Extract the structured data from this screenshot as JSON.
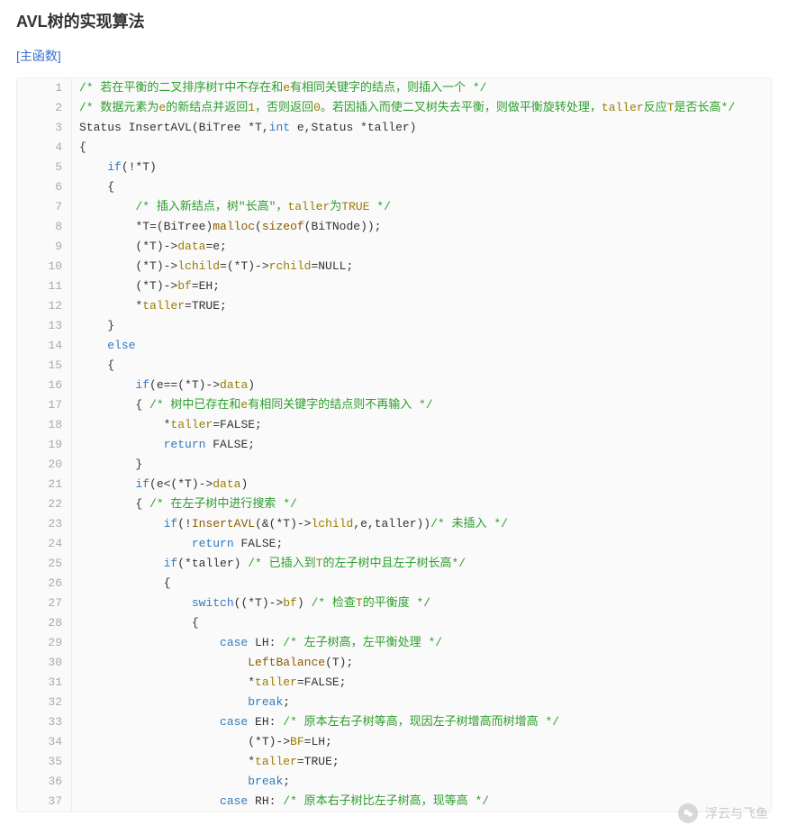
{
  "title": "AVL树的实现算法",
  "section_label": "[主函数]",
  "watermark": "浮云与飞鱼",
  "code_lines": [
    {
      "n": 1,
      "seg": [
        [
          "comment",
          "/* 若在平衡的二叉排序树T中不存在和"
        ],
        [
          "id",
          "e"
        ],
        [
          "comment",
          "有相同关键字的结点，则插入一个 */"
        ]
      ]
    },
    {
      "n": 2,
      "seg": [
        [
          "comment",
          "/* 数据元素为"
        ],
        [
          "id",
          "e"
        ],
        [
          "comment",
          "的新结点并返回"
        ],
        [
          "id",
          "1"
        ],
        [
          "comment",
          "，否则返回"
        ],
        [
          "id",
          "0"
        ],
        [
          "comment",
          "。若因插入而使二叉树失去平衡，则做平衡旋转处理，"
        ],
        [
          "id",
          "taller"
        ],
        [
          "comment",
          "反应"
        ],
        [
          "id",
          "T"
        ],
        [
          "comment",
          "是否长高*/"
        ]
      ]
    },
    {
      "n": 3,
      "seg": [
        [
          "plain",
          "Status InsertAVL(BiTree *T,"
        ],
        [
          "type",
          "int"
        ],
        [
          "plain",
          " e,Status *taller)"
        ]
      ]
    },
    {
      "n": 4,
      "seg": [
        [
          "plain",
          "{"
        ]
      ]
    },
    {
      "n": 5,
      "seg": [
        [
          "plain",
          "    "
        ],
        [
          "flow",
          "if"
        ],
        [
          "plain",
          "(!*T)"
        ]
      ]
    },
    {
      "n": 6,
      "seg": [
        [
          "plain",
          "    {"
        ]
      ]
    },
    {
      "n": 7,
      "seg": [
        [
          "plain",
          "        "
        ],
        [
          "comment",
          "/* 插入新结点，树\"长高\"，"
        ],
        [
          "id",
          "taller"
        ],
        [
          "comment",
          "为"
        ],
        [
          "id",
          "TRUE"
        ],
        [
          "comment",
          " */"
        ]
      ]
    },
    {
      "n": 8,
      "seg": [
        [
          "plain",
          "        *T=(BiTree)"
        ],
        [
          "call",
          "malloc"
        ],
        [
          "plain",
          "("
        ],
        [
          "call",
          "sizeof"
        ],
        [
          "plain",
          "(BiTNode));"
        ]
      ]
    },
    {
      "n": 9,
      "seg": [
        [
          "plain",
          "        (*T)->"
        ],
        [
          "id",
          "data"
        ],
        [
          "plain",
          "=e;"
        ]
      ]
    },
    {
      "n": 10,
      "seg": [
        [
          "plain",
          "        (*T)->"
        ],
        [
          "id",
          "lchild"
        ],
        [
          "plain",
          "=(*T)->"
        ],
        [
          "id",
          "rchild"
        ],
        [
          "plain",
          "=NULL;"
        ]
      ]
    },
    {
      "n": 11,
      "seg": [
        [
          "plain",
          "        (*T)->"
        ],
        [
          "id",
          "bf"
        ],
        [
          "plain",
          "=EH;"
        ]
      ]
    },
    {
      "n": 12,
      "seg": [
        [
          "plain",
          "        *"
        ],
        [
          "id",
          "taller"
        ],
        [
          "plain",
          "=TRUE;"
        ]
      ]
    },
    {
      "n": 13,
      "seg": [
        [
          "plain",
          "    }"
        ]
      ]
    },
    {
      "n": 14,
      "seg": [
        [
          "plain",
          "    "
        ],
        [
          "flow",
          "else"
        ]
      ]
    },
    {
      "n": 15,
      "seg": [
        [
          "plain",
          "    {"
        ]
      ]
    },
    {
      "n": 16,
      "seg": [
        [
          "plain",
          "        "
        ],
        [
          "flow",
          "if"
        ],
        [
          "plain",
          "(e==(*T)->"
        ],
        [
          "id",
          "data"
        ],
        [
          "plain",
          ")"
        ]
      ]
    },
    {
      "n": 17,
      "seg": [
        [
          "plain",
          "        { "
        ],
        [
          "comment",
          "/* 树中已存在和"
        ],
        [
          "id",
          "e"
        ],
        [
          "comment",
          "有相同关键字的结点则不再输入 */"
        ]
      ]
    },
    {
      "n": 18,
      "seg": [
        [
          "plain",
          "            *"
        ],
        [
          "id",
          "taller"
        ],
        [
          "plain",
          "=FALSE;"
        ]
      ]
    },
    {
      "n": 19,
      "seg": [
        [
          "plain",
          "            "
        ],
        [
          "flow",
          "return"
        ],
        [
          "plain",
          " FALSE;"
        ]
      ]
    },
    {
      "n": 20,
      "seg": [
        [
          "plain",
          "        }"
        ]
      ]
    },
    {
      "n": 21,
      "seg": [
        [
          "plain",
          "        "
        ],
        [
          "flow",
          "if"
        ],
        [
          "plain",
          "(e<(*T)->"
        ],
        [
          "id",
          "data"
        ],
        [
          "plain",
          ")"
        ]
      ]
    },
    {
      "n": 22,
      "seg": [
        [
          "plain",
          "        { "
        ],
        [
          "comment",
          "/* 在左子树中进行搜索 */"
        ]
      ]
    },
    {
      "n": 23,
      "seg": [
        [
          "plain",
          "            "
        ],
        [
          "flow",
          "if"
        ],
        [
          "plain",
          "(!"
        ],
        [
          "call",
          "InsertAVL"
        ],
        [
          "plain",
          "(&(*T)->"
        ],
        [
          "id",
          "lchild"
        ],
        [
          "plain",
          ",e,taller))"
        ],
        [
          "comment",
          "/* 未插入 */"
        ]
      ]
    },
    {
      "n": 24,
      "seg": [
        [
          "plain",
          "                "
        ],
        [
          "flow",
          "return"
        ],
        [
          "plain",
          " FALSE;"
        ]
      ]
    },
    {
      "n": 25,
      "seg": [
        [
          "plain",
          "            "
        ],
        [
          "flow",
          "if"
        ],
        [
          "plain",
          "(*taller) "
        ],
        [
          "comment",
          "/* 已插入到"
        ],
        [
          "id",
          "T"
        ],
        [
          "comment",
          "的左子树中且左子树长高*/"
        ]
      ]
    },
    {
      "n": 26,
      "seg": [
        [
          "plain",
          "            {"
        ]
      ]
    },
    {
      "n": 27,
      "seg": [
        [
          "plain",
          "                "
        ],
        [
          "flow",
          "switch"
        ],
        [
          "plain",
          "((*T)->"
        ],
        [
          "id",
          "bf"
        ],
        [
          "plain",
          ") "
        ],
        [
          "comment",
          "/* 检查"
        ],
        [
          "id",
          "T"
        ],
        [
          "comment",
          "的平衡度 */"
        ]
      ]
    },
    {
      "n": 28,
      "seg": [
        [
          "plain",
          "                {"
        ]
      ]
    },
    {
      "n": 29,
      "seg": [
        [
          "plain",
          "                    "
        ],
        [
          "flow",
          "case"
        ],
        [
          "plain",
          " LH: "
        ],
        [
          "comment",
          "/* 左子树高，左平衡处理 */"
        ]
      ]
    },
    {
      "n": 30,
      "seg": [
        [
          "plain",
          "                        "
        ],
        [
          "call",
          "LeftBalance"
        ],
        [
          "plain",
          "(T);"
        ]
      ]
    },
    {
      "n": 31,
      "seg": [
        [
          "plain",
          "                        *"
        ],
        [
          "id",
          "taller"
        ],
        [
          "plain",
          "=FALSE;"
        ]
      ]
    },
    {
      "n": 32,
      "seg": [
        [
          "plain",
          "                        "
        ],
        [
          "flow",
          "break"
        ],
        [
          "plain",
          ";"
        ]
      ]
    },
    {
      "n": 33,
      "seg": [
        [
          "plain",
          "                    "
        ],
        [
          "flow",
          "case"
        ],
        [
          "plain",
          " EH: "
        ],
        [
          "comment",
          "/* 原本左右子树等高，现因左子树增高而树增高 */"
        ]
      ]
    },
    {
      "n": 34,
      "seg": [
        [
          "plain",
          "                        (*T)->"
        ],
        [
          "id",
          "BF"
        ],
        [
          "plain",
          "=LH;"
        ]
      ]
    },
    {
      "n": 35,
      "seg": [
        [
          "plain",
          "                        *"
        ],
        [
          "id",
          "taller"
        ],
        [
          "plain",
          "=TRUE;"
        ]
      ]
    },
    {
      "n": 36,
      "seg": [
        [
          "plain",
          "                        "
        ],
        [
          "flow",
          "break"
        ],
        [
          "plain",
          ";"
        ]
      ]
    },
    {
      "n": 37,
      "seg": [
        [
          "plain",
          "                    "
        ],
        [
          "flow",
          "case"
        ],
        [
          "plain",
          " RH: "
        ],
        [
          "comment",
          "/* 原本右子树比左子树高，现等高 */"
        ]
      ]
    }
  ]
}
